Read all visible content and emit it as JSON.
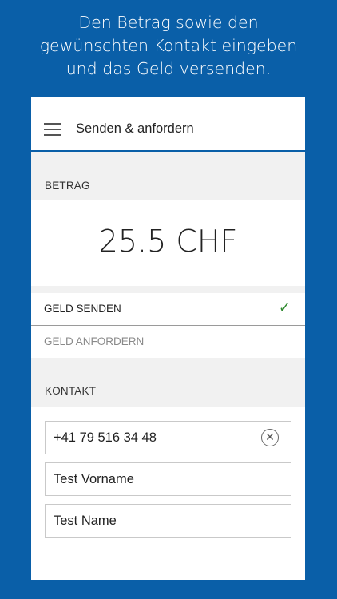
{
  "promo": {
    "line1": "Den Betrag sowie den",
    "line2": "gewünschten Kontakt eingeben",
    "line3": "und das Geld versenden."
  },
  "appbar": {
    "title": "Senden & anfordern",
    "menu_icon": "hamburger-menu-icon"
  },
  "amount_section": {
    "label": "BETRAG",
    "value": "25.5 CHF"
  },
  "mode_options": [
    {
      "label": "GELD SENDEN",
      "selected": true,
      "icon": "checkmark-icon"
    },
    {
      "label": "GELD ANFORDERN",
      "selected": false
    }
  ],
  "contact_section": {
    "label": "KONTAKT",
    "phone": "+41 79 516 34 48",
    "firstname": "Test Vorname",
    "lastname": "Test Name",
    "clear_icon": "clear-circle-icon"
  },
  "colors": {
    "brand_blue": "#0a5fa8",
    "check_green": "#2f8a2f"
  }
}
